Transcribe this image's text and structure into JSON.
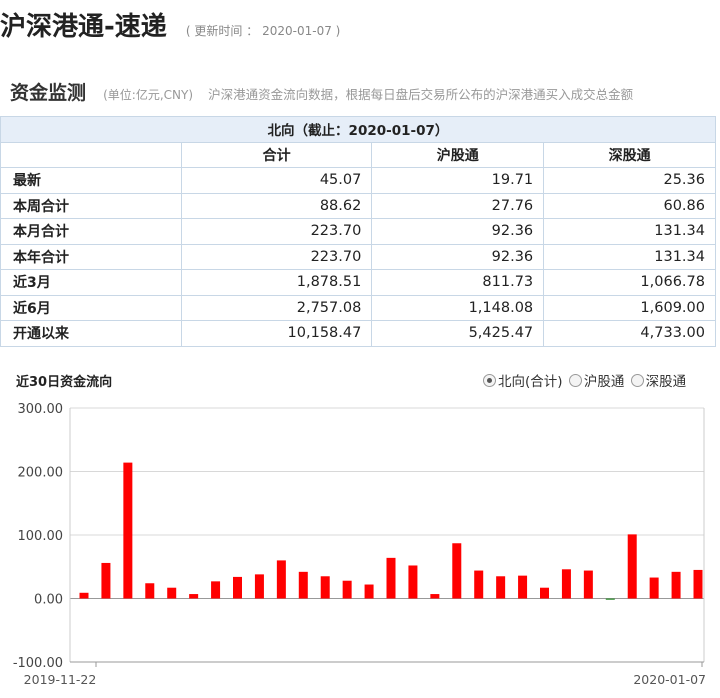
{
  "header": {
    "title": "沪深港通-速递",
    "updated_label": "更新时间",
    "updated_sep": "：",
    "updated_value": "2020-01-07"
  },
  "section": {
    "title": "资金监测",
    "unit": "(单位:亿元,CNY)",
    "description": "沪深港通资金流向数据，根据每日盘后交易所公布的沪深港通买入成交总金额"
  },
  "table": {
    "caption": "北向（截止：2020-01-07）",
    "headers": [
      "",
      "合计",
      "沪股通",
      "深股通"
    ],
    "rows": [
      {
        "label": "最新",
        "values": [
          "45.07",
          "19.71",
          "25.36"
        ]
      },
      {
        "label": "本周合计",
        "values": [
          "88.62",
          "27.76",
          "60.86"
        ]
      },
      {
        "label": "本月合计",
        "values": [
          "223.70",
          "92.36",
          "131.34"
        ]
      },
      {
        "label": "本年合计",
        "values": [
          "223.70",
          "92.36",
          "131.34"
        ]
      },
      {
        "label": "近3月",
        "values": [
          "1,878.51",
          "811.73",
          "1,066.78"
        ]
      },
      {
        "label": "近6月",
        "values": [
          "2,757.08",
          "1,148.08",
          "1,609.00"
        ]
      },
      {
        "label": "开通以来",
        "values": [
          "10,158.47",
          "5,425.47",
          "4,733.00"
        ]
      }
    ]
  },
  "chart_section": {
    "title": "近30日资金流向",
    "options": [
      {
        "label": "北向(合计)",
        "selected": true
      },
      {
        "label": "沪股通",
        "selected": false
      },
      {
        "label": "深股通",
        "selected": false
      }
    ]
  },
  "chart_data": {
    "type": "bar",
    "title": "近30日资金流向",
    "x_start_label": "2019-11-22",
    "x_end_label": "2020-01-07",
    "ylim": [
      -100,
      300
    ],
    "yticks": [
      "300.00",
      "200.00",
      "100.00",
      "0.00",
      "-100.00"
    ],
    "ytick_values": [
      300,
      200,
      100,
      0,
      -100
    ],
    "positive_color": "#ff0000",
    "negative_color": "#2e8b2e",
    "grid": true,
    "values": [
      9,
      56,
      214,
      24,
      17,
      7,
      27,
      34,
      38,
      60,
      42,
      35,
      28,
      22,
      64,
      52,
      7,
      87,
      44,
      35,
      36,
      17,
      46,
      44,
      -2,
      101,
      33,
      42,
      45
    ]
  }
}
